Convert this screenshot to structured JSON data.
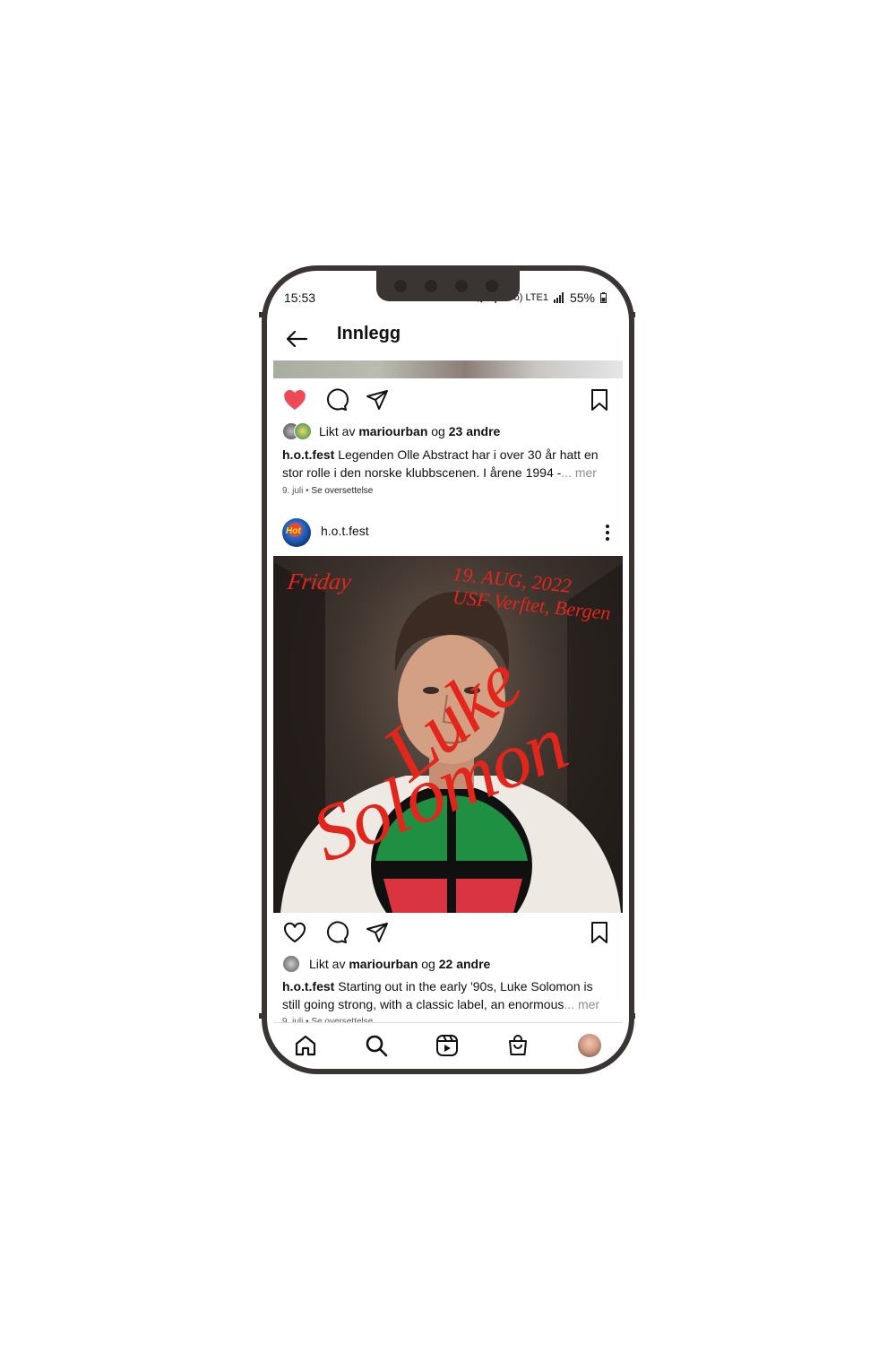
{
  "status_bar": {
    "time": "15:53",
    "network": "Vo) LTE1",
    "battery": "55%"
  },
  "header": {
    "title": "Innlegg"
  },
  "post1": {
    "liked": true,
    "likes_text_prefix": "Likt av",
    "liked_by_user": "mariourban",
    "likes_text_join": "og",
    "likes_others": "23 andre",
    "caption_user": "h.o.t.fest",
    "caption_line1": "Legenden Olle Abstract har i over 30 år hatt en",
    "caption_line2": "stor rolle i den norske klubbscenen. I årene 1994 -",
    "more": "... mer",
    "date": "9. juli",
    "translate": "Se oversettelse"
  },
  "post2": {
    "username": "h.o.t.fest",
    "avatar_text": "Hot",
    "poster": {
      "day": "Friday",
      "date": "19. AUG, 2022",
      "venue": "USF Verftet, Bergen",
      "first_name": "Luke",
      "last_name": "Solomon"
    },
    "liked": false,
    "likes_text_prefix": "Likt av",
    "liked_by_user": "mariourban",
    "likes_text_join": "og",
    "likes_others": "22 andre",
    "caption_user": "h.o.t.fest",
    "caption_line1": "Starting out in the early '90s, Luke Solomon is",
    "caption_line2": "still going strong, with a classic label, an enormous",
    "more": "... mer",
    "date_partial": "9. juli • Se oversettelse"
  },
  "nav": [
    "home-icon",
    "search-icon",
    "reels-icon",
    "shop-icon",
    "profile-avatar"
  ],
  "colors": {
    "like_red": "#ed4956",
    "poster_red": "#e3261b",
    "frame": "#3a3433"
  }
}
